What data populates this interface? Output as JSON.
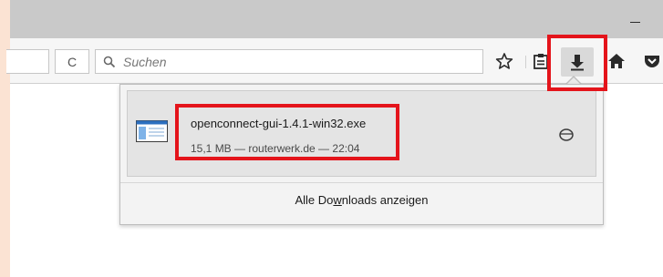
{
  "toolbar": {
    "reload_glyph": "C",
    "search_placeholder": "Suchen",
    "icons": [
      "star-icon",
      "clipboard-icon",
      "download-icon",
      "home-icon",
      "pocket-icon"
    ]
  },
  "downloads_panel": {
    "item": {
      "file_name": "openconnect-gui-1.4.1-win32.exe",
      "meta": "15,1 MB — routerwerk.de — 22:04"
    },
    "show_all_prefix": "Alle Do",
    "show_all_access_key": "w",
    "show_all_suffix": "nloads anzeigen"
  },
  "colors": {
    "highlight": "#e4141b",
    "titlebar": "#c9c9c9",
    "background": "#fbe3d3"
  }
}
